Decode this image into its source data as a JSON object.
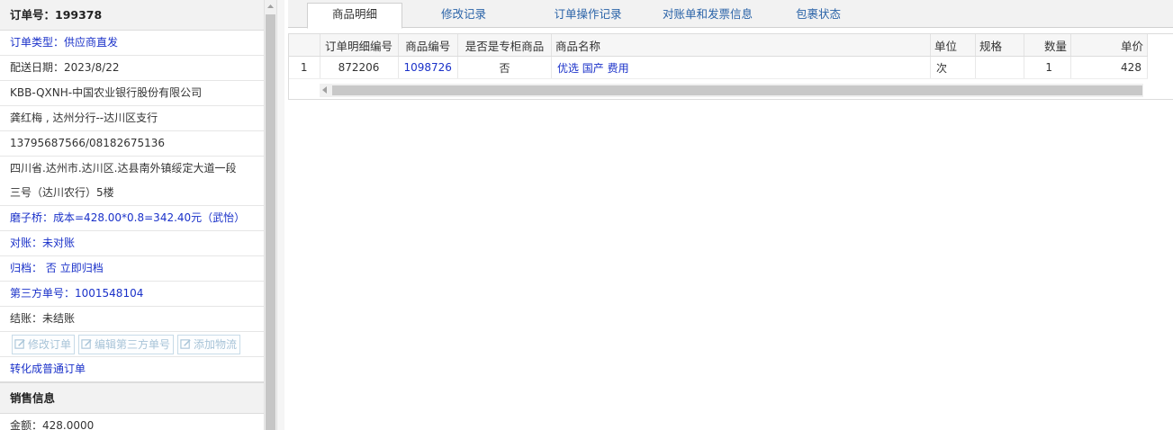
{
  "order": {
    "number": "订单号：199378",
    "type": "订单类型：供应商直发",
    "delivery_date": "配送日期：2023/8/22",
    "customer": "KBB-QXNH-中国农业银行股份有限公司",
    "contact": "龚红梅 , 达州分行--达川区支行",
    "phone": "13795687566/08182675136",
    "address_line1": "四川省.达州市.达川区.达县南外镇绥定大道一段",
    "address_line2": "三号（达川农行）5楼",
    "cost_note": "磨子桥：成本=428.00*0.8=342.40元（武怡）",
    "reconcile": "对账：未对账",
    "archive_label": "归档：",
    "archive_value": "否",
    "archive_action": "立即归档",
    "third_party": "第三方单号：1001548104",
    "settle": "结账：未结账",
    "buttons": {
      "edit_order": "修改订单",
      "edit_third_party": "编辑第三方单号",
      "add_logistics": "添加物流"
    },
    "convert": "转化成普通订单"
  },
  "sales": {
    "title": "销售信息",
    "amount": "金额：428.0000"
  },
  "tabs": [
    {
      "label": "商品明细",
      "active": true
    },
    {
      "label": "修改记录",
      "active": false
    },
    {
      "label": "订单操作记录",
      "active": false
    },
    {
      "label": "对账单和发票信息",
      "active": false
    },
    {
      "label": "包裹状态",
      "active": false
    }
  ],
  "grid": {
    "headers": [
      "订单明细编号",
      "商品编号",
      "是否是专柜商品",
      "商品名称",
      "单位",
      "规格",
      "数量",
      "单价"
    ],
    "rows": [
      {
        "index": "1",
        "detail_no": "872206",
        "product_no": "1098726",
        "is_counter": "否",
        "name": "优选 国产 费用",
        "unit": "次",
        "spec": "",
        "qty": "1",
        "price": "428"
      }
    ]
  }
}
